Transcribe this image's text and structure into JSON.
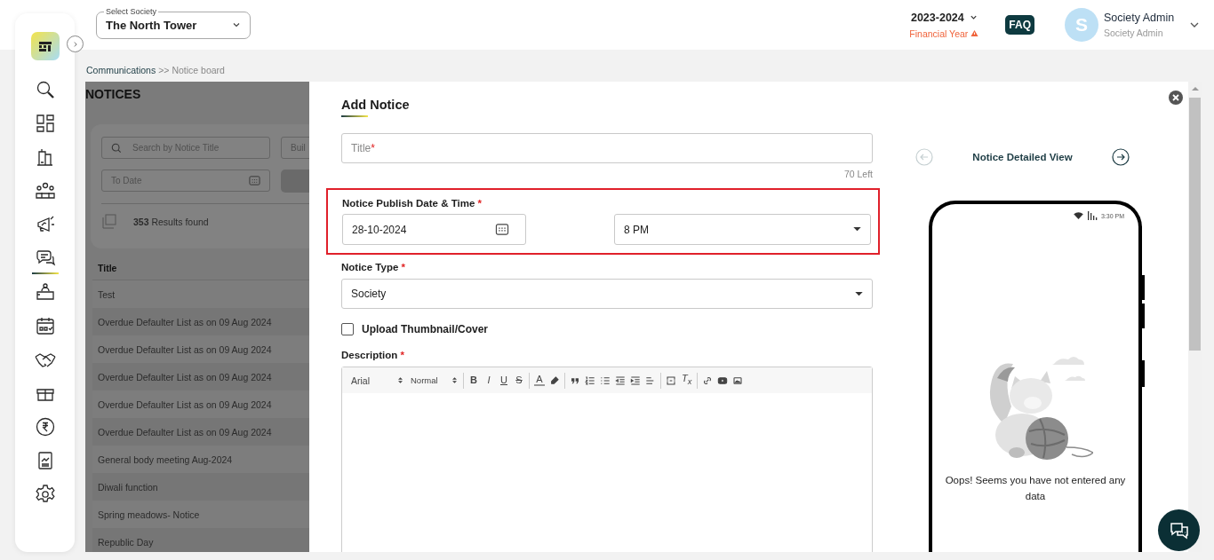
{
  "sidebar": {
    "nav": [
      {
        "selected": false
      },
      {
        "selected": false
      },
      {
        "selected": false
      },
      {
        "selected": false
      },
      {
        "selected": false
      },
      {
        "selected": true
      },
      {
        "selected": false
      },
      {
        "selected": false
      },
      {
        "selected": false
      },
      {
        "selected": false
      },
      {
        "selected": false
      },
      {
        "selected": false
      },
      {
        "selected": false
      }
    ]
  },
  "header": {
    "society_select": {
      "label": "Select Society",
      "value": "The North Tower"
    },
    "financial_year": {
      "value": "2023-2024",
      "caption": "Financial Year",
      "warning": true
    },
    "faq": "FAQ",
    "user": {
      "initial": "S",
      "name": "Society Admin",
      "role": "Society Admin"
    }
  },
  "breadcrumb": {
    "parent": "Communications",
    "separator": ">>",
    "current": "Notice board"
  },
  "notices_page": {
    "title": "NOTICES",
    "search_placeholder": "Search by Notice Title",
    "building_placeholder": "Buil",
    "to_date_placeholder": "To Date",
    "select_all_checked": false,
    "results": "**353** Results found",
    "column": "Title",
    "rows": [
      "Test",
      "Overdue Defaulter List as on 09 Aug 2024",
      "Overdue Defaulter List as on 09 Aug 2024",
      "Overdue Defaulter List as on 09 Aug 2024",
      "Overdue Defaulter List as on 09 Aug 2024",
      "Overdue Defaulter List as on 09 Aug 2024",
      "General body meeting Aug-2024",
      "Diwali function",
      "Spring meadows- Notice",
      "Republic Day"
    ]
  },
  "add_notice": {
    "heading": "Add Notice",
    "title_field": {
      "placeholder": "Title",
      "required_mark": "*",
      "counter": "70 Left"
    },
    "publish": {
      "label": "Notice Publish Date & Time",
      "required_mark": "*",
      "highlighted": true,
      "date": "28-10-2024",
      "time": "8 PM"
    },
    "notice_type": {
      "label": "Notice Type",
      "required_mark": "*",
      "value": "Society"
    },
    "thumbnail": {
      "label": "Upload Thumbnail/Cover",
      "checked": false
    },
    "description": {
      "label": "Description",
      "required_mark": "*",
      "toolbar": [
        {
          "kind": "select",
          "text": "Arial"
        },
        {
          "kind": "select",
          "text": "Normal"
        },
        {
          "kind": "separator"
        },
        {
          "kind": "bold",
          "text": "B"
        },
        {
          "kind": "italic",
          "text": "I"
        },
        {
          "kind": "underline",
          "text": "U"
        },
        {
          "kind": "strike",
          "text": "S"
        },
        {
          "kind": "separator"
        },
        {
          "kind": "color",
          "text": "A"
        },
        {
          "kind": "highlight"
        },
        {
          "kind": "separator"
        },
        {
          "kind": "quote"
        },
        {
          "kind": "ordered"
        },
        {
          "kind": "bullet"
        },
        {
          "kind": "outdent"
        },
        {
          "kind": "indent"
        },
        {
          "kind": "align"
        },
        {
          "kind": "separator"
        },
        {
          "kind": "divider"
        },
        {
          "kind": "clean",
          "text": "T$_{x}$"
        },
        {
          "kind": "separator"
        },
        {
          "kind": "link"
        },
        {
          "kind": "video"
        },
        {
          "kind": "image"
        }
      ]
    }
  },
  "preview": {
    "title": "Notice Detailed View",
    "prev_disabled": true,
    "next_disabled": false,
    "status_time": "3:30 PM",
    "message": "Oops! Seems you have not entered any data"
  }
}
